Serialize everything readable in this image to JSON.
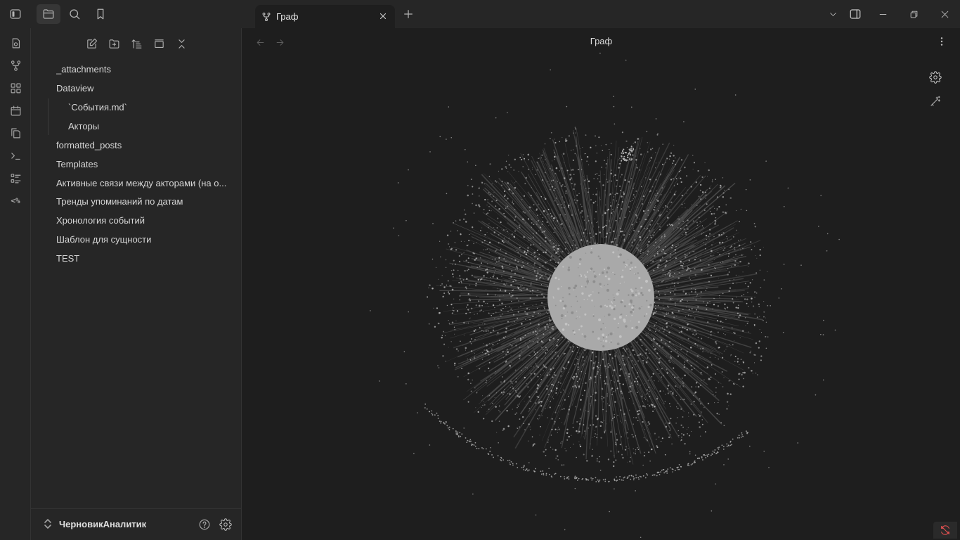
{
  "tab": {
    "title": "Граф",
    "icon": "git-fork-icon"
  },
  "view": {
    "title": "Граф"
  },
  "sidebar": {
    "items": [
      {
        "label": "_attachments",
        "type": "folder",
        "expanded": false
      },
      {
        "label": "Dataview",
        "type": "folder",
        "expanded": true
      },
      {
        "label": "`События.md`",
        "type": "file",
        "indent": 1
      },
      {
        "label": "Акторы",
        "type": "file",
        "indent": 1
      },
      {
        "label": "formatted_posts",
        "type": "folder",
        "expanded": false
      },
      {
        "label": "Templates",
        "type": "folder",
        "expanded": false
      },
      {
        "label": "Активные связи между акторами (на о...",
        "type": "file"
      },
      {
        "label": "Тренды упоминаний по датам",
        "type": "file"
      },
      {
        "label": "Хронология событий",
        "type": "file"
      },
      {
        "label": "Шаблон для сущности",
        "type": "file"
      },
      {
        "label": "TEST",
        "type": "file"
      }
    ]
  },
  "vault": {
    "name": "ЧерновикАналитик"
  },
  "colors": {
    "background": "#1e1e1e",
    "panel": "#262626",
    "node": "#b5b5b5",
    "edge": "#4a4a4a",
    "sync_error": "#e05050"
  }
}
